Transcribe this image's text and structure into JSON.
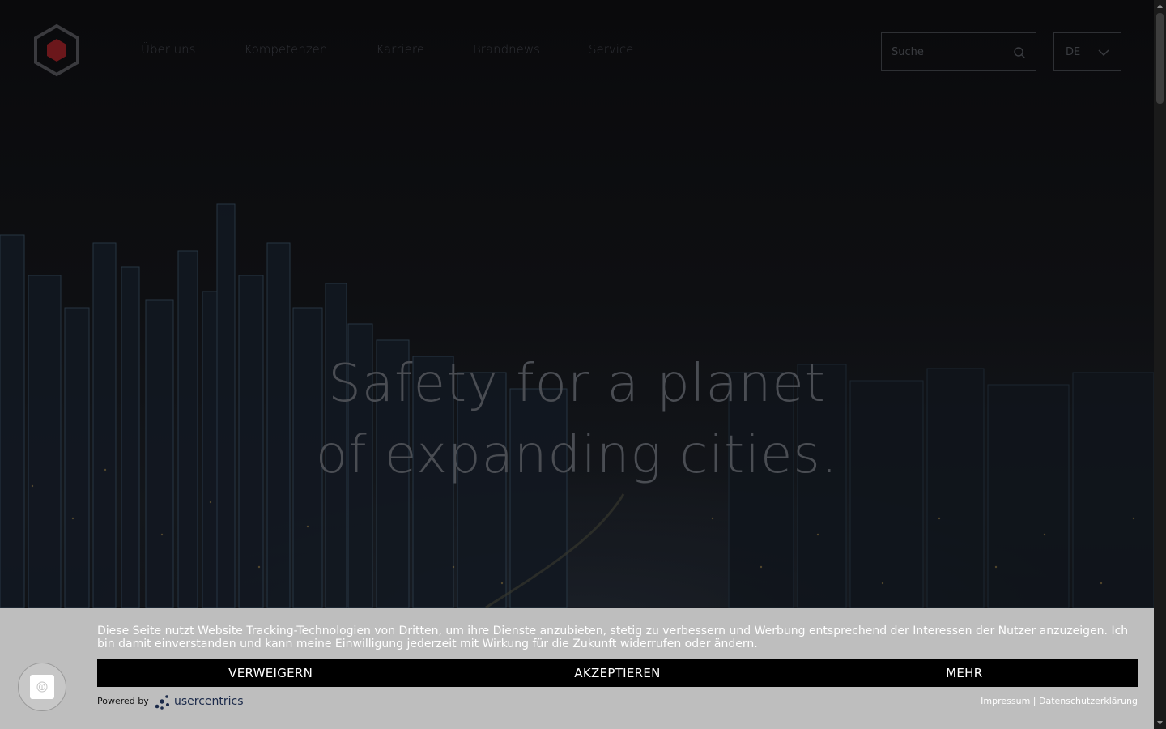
{
  "nav": {
    "items": [
      "Über uns",
      "Kompetenzen",
      "Karriere",
      "Brandnews",
      "Service"
    ]
  },
  "search": {
    "placeholder": "Suche"
  },
  "language": {
    "selected": "DE"
  },
  "hero": {
    "line1": "Safety for a planet",
    "line2": "of expanding cities."
  },
  "cookie": {
    "text": "Diese Seite nutzt Website Tracking-Technologien von Dritten, um ihre Dienste anzubieten, stetig zu verbessern und Werbung entsprechend der Interessen der Nutzer anzuzeigen. Ich bin damit einverstanden und kann meine Einwilligung jederzeit mit Wirkung für die Zukunft widerrufen oder ändern.",
    "deny_label": "VERWEIGERN",
    "accept_label": "AKZEPTIEREN",
    "more_label": "MEHR",
    "powered_by": "Powered by",
    "provider": "usercentrics",
    "imprint": "Impressum",
    "separator": "|",
    "privacy": "Datenschutzerklärung"
  },
  "colors": {
    "logo_red": "#7a1a1f",
    "banner_bg": "#bebebe",
    "button_bar": "#000000"
  },
  "icons": [
    "logo-hexagon-icon",
    "search-icon",
    "chevron-down-icon",
    "fingerprint-icon",
    "usercentrics-logo-icon"
  ]
}
